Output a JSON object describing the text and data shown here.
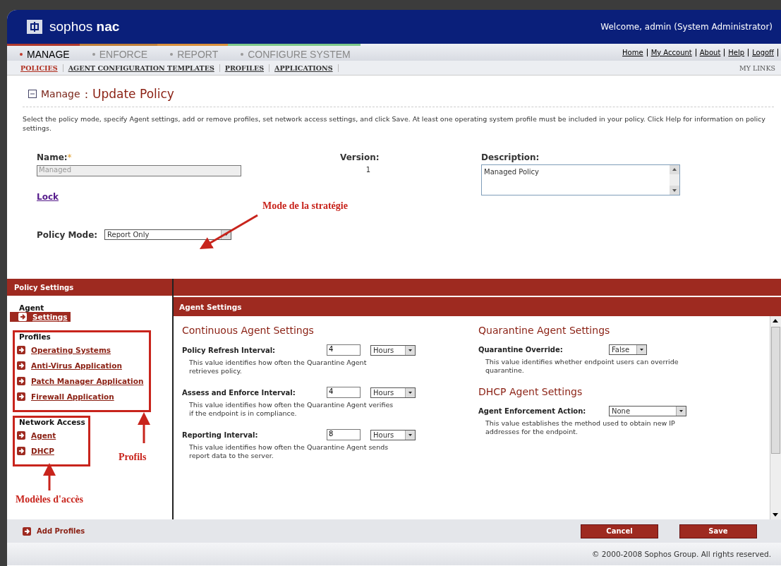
{
  "header": {
    "logo": "sophos",
    "logo_bold": "nac",
    "welcome": "Welcome, admin (System Administrator)"
  },
  "main_tabs": [
    {
      "label": "MANAGE",
      "selected": true,
      "color": "#b03a2e"
    },
    {
      "label": "ENFORCE",
      "selected": false,
      "color": "#c0803a"
    },
    {
      "label": "REPORT",
      "selected": false,
      "color": "#d9903c"
    },
    {
      "label": "CONFIGURE SYSTEM",
      "selected": false,
      "color": "#7fc98a"
    }
  ],
  "top_links": [
    "Home",
    "My Account",
    "About",
    "Help",
    "Logoff"
  ],
  "sub_tabs": [
    {
      "label": "POLICIES",
      "selected": true
    },
    {
      "label": "AGENT CONFIGURATION TEMPLATES",
      "selected": false
    },
    {
      "label": "PROFILES",
      "selected": false
    },
    {
      "label": "APPLICATIONS",
      "selected": false
    }
  ],
  "my_links": "MY LINKS",
  "page": {
    "section": "Manage",
    "separator": ":",
    "title": "Update Policy",
    "intro": "Select the policy mode, specify Agent settings, add or remove profiles, set network access settings, and click Save. At least one operating system profile must be included in your policy. Click Help for information on policy settings."
  },
  "form": {
    "name_label": "Name:",
    "required": "*",
    "name_value": "Managed",
    "version_label": "Version:",
    "version": "1",
    "description_label": "Description:",
    "description": "Managed Policy",
    "lock": "Lock",
    "policy_mode_label": "Policy Mode:",
    "policy_mode": "Report Only"
  },
  "policy_settings": "Policy Settings",
  "sidebar": [
    {
      "heading": "Agent",
      "framed": false,
      "items": [
        {
          "label": "Settings",
          "selected": true
        }
      ]
    },
    {
      "heading": "Profiles",
      "framed": true,
      "items": [
        {
          "label": "Operating Systems",
          "selected": false
        },
        {
          "label": "Anti-Virus Application",
          "selected": false
        },
        {
          "label": "Patch Manager Application",
          "selected": false
        },
        {
          "label": "Firewall Application",
          "selected": false
        }
      ]
    },
    {
      "heading": "Network Access",
      "framed": true,
      "items": [
        {
          "label": "Agent",
          "selected": false
        },
        {
          "label": "DHCP",
          "selected": false
        }
      ]
    }
  ],
  "panel_title": "Agent Settings",
  "columns": [
    {
      "sections": [
        {
          "title": "Continuous Agent Settings",
          "fields": [
            {
              "kind": "number",
              "label": "Policy Refresh Interval:",
              "value": "4",
              "unit": "Hours",
              "help": "This value identifies how often the Quarantine Agent retrieves policy."
            },
            {
              "kind": "number",
              "label": "Assess and Enforce Interval:",
              "value": "4",
              "unit": "Hours",
              "help": "This value identifies how often the Quarantine Agent verifies if the endpoint is in compliance."
            },
            {
              "kind": "number",
              "label": "Reporting Interval:",
              "value": "8",
              "unit": "Hours",
              "help": "This value identifies how often the Quarantine Agent sends report data to the server."
            }
          ]
        }
      ]
    },
    {
      "sections": [
        {
          "title": "Quarantine Agent Settings",
          "fields": [
            {
              "kind": "select",
              "label": "Quarantine Override:",
              "value": "False",
              "help": "This value identifies whether endpoint users can override quarantine."
            }
          ]
        },
        {
          "title": "DHCP Agent Settings",
          "fields": [
            {
              "kind": "wideselect",
              "label": "Agent Enforcement Action:",
              "value": "None",
              "help": "This value establishes the method used to obtain new IP addresses for the endpoint."
            }
          ]
        }
      ]
    }
  ],
  "footer": {
    "add_profiles": "Add Profiles",
    "buttons": [
      "Cancel",
      "Save"
    ],
    "copyright": "© 2000-2008 Sophos Group. All rights reserved."
  },
  "annotations": [
    {
      "text": "Mode de la stratégie"
    },
    {
      "text": "Profils"
    },
    {
      "text": "Modèles d'accès"
    }
  ]
}
